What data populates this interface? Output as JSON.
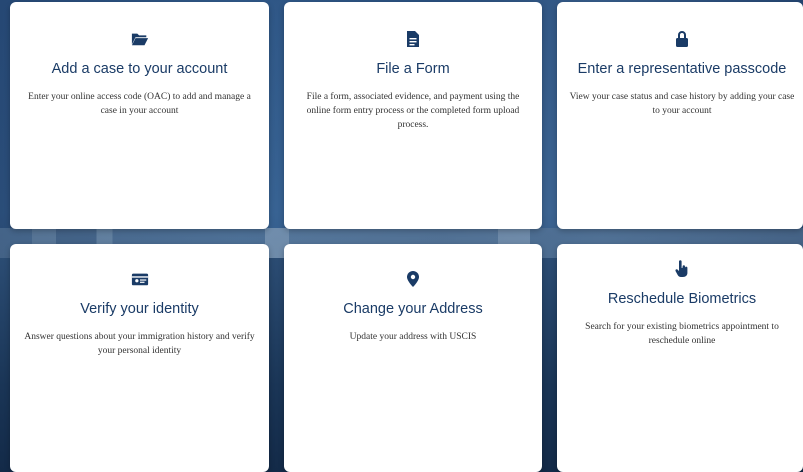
{
  "cards": [
    {
      "icon": "folder-open-icon",
      "title": "Add a case to your account",
      "description": "Enter your online access code (OAC) to add and manage a case in your account"
    },
    {
      "icon": "file-icon",
      "title": "File a Form",
      "description": "File a form, associated evidence, and payment using the online form entry process or the completed form upload process."
    },
    {
      "icon": "lock-icon",
      "title": "Enter a representative passcode",
      "description": "View your case status and case history by adding your case to your account"
    },
    {
      "icon": "id-card-icon",
      "title": "Verify your identity",
      "description": "Answer questions about your immigration history and verify your personal identity"
    },
    {
      "icon": "map-marker-icon",
      "title": "Change your Address",
      "description": "Update your address with USCIS"
    },
    {
      "icon": "hand-pointer-icon",
      "title": "Reschedule Biometrics",
      "description": "Search for your existing biometrics appointment to reschedule online"
    }
  ],
  "colors": {
    "title": "#1a3b66",
    "text": "#333333",
    "card_bg": "#ffffff"
  }
}
